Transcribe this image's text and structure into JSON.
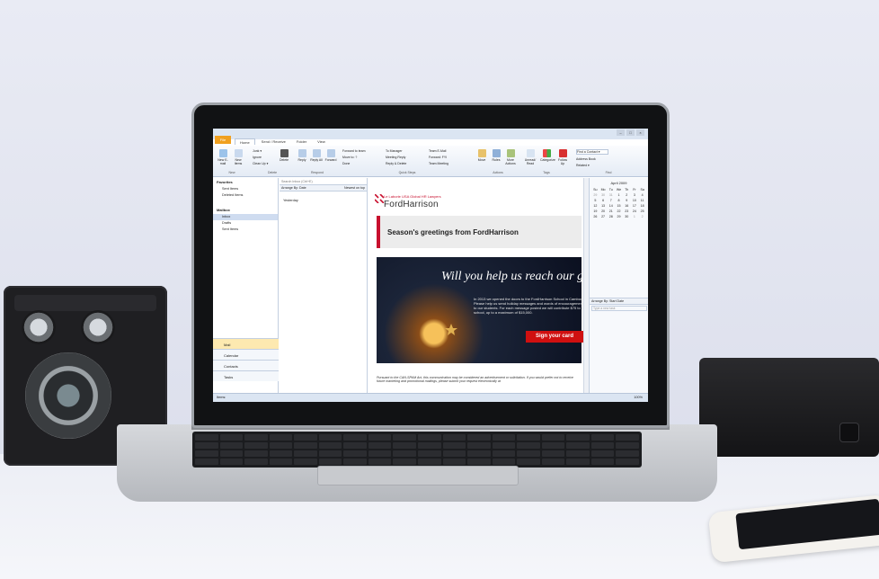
{
  "outlook": {
    "file_tab": "File",
    "tabs": [
      "Home",
      "Send / Receive",
      "Folder",
      "View"
    ],
    "window_controls": [
      "–",
      "□",
      "×"
    ],
    "ribbon": {
      "new_email": "New E-mail",
      "new_items": "New Items",
      "group_new": "New",
      "junk": "Junk ▾",
      "ignore": "Ignore",
      "clean_up": "Clean Up ▾",
      "delete": "Delete",
      "group_delete": "Delete",
      "reply": "Reply",
      "reply_all": "Reply All",
      "forward": "Forward",
      "group_respond": "Respond",
      "quick_steps": [
        "Forward to team",
        "Move to: ?",
        "Done",
        "To Manager",
        "Meeting Reply",
        "Reply & Delete",
        "Team E-Mail",
        "Forward: FYI",
        "Team Meeting"
      ],
      "group_quick_steps": "Quick Steps",
      "move": "Move",
      "rules": "Rules",
      "more_actions": "More Actions",
      "group_actions": "Actions",
      "unread_read": "Unread/ Read",
      "categorize": "Categorize",
      "follow_up": "Follow Up",
      "group_tags": "Tags",
      "find_contact": "Find a Contact ▾",
      "address_book": "Address Book",
      "related": "Related ▾",
      "group_find": "Find"
    },
    "nav": {
      "favorites": "Favorites",
      "favorites_items": [
        "Sent Items",
        "Deleted Items"
      ],
      "mailbox": "Mailbox",
      "mailbox_items": [
        "Inbox",
        "Drafts",
        "Sent Items"
      ],
      "sections": [
        "Mail",
        "Calendar",
        "Contacts",
        "Tasks"
      ]
    },
    "list": {
      "search_placeholder": "Search Inbox (Ctrl+E)",
      "arrange": "Arrange By: Date",
      "order": "Newest on top",
      "group": "Yesterday"
    },
    "message": {
      "tagline": "Le Laborie USA Global HR Lawyers",
      "brand": "FordHarrison",
      "greeting": "Season's greetings from FordHarrison",
      "hero_title": "Will you help us reach our goal?",
      "hero_body": "In 2013 we opened the doors to the FordHarrison School in Cambodia. Please help us send holiday messages and words of encouragement to our students. For each message posted we will contribute $75 to the school, up to a maximum of $15,000.",
      "cta": "Sign your card",
      "footer": "Pursuant to the CAN-SPAM Act, this communication may be considered an advertisement or solicitation. If you would prefer not to receive future marketing and promotional mailings, please submit your request electronically at"
    },
    "todo": {
      "month": "April 2009",
      "weekdays": [
        "Su",
        "Mo",
        "Tu",
        "We",
        "Th",
        "Fr",
        "Sa"
      ],
      "days": [
        "29",
        "30",
        "31",
        "1",
        "2",
        "3",
        "4",
        "5",
        "6",
        "7",
        "8",
        "9",
        "10",
        "11",
        "12",
        "13",
        "14",
        "15",
        "16",
        "17",
        "18",
        "19",
        "20",
        "21",
        "22",
        "23",
        "24",
        "25",
        "26",
        "27",
        "28",
        "29",
        "30",
        "1",
        "2"
      ],
      "arrange": "Arrange By: Start Date",
      "new_task_placeholder": "Type a new task"
    },
    "status": {
      "items": "Items: ",
      "zoom": "100%"
    }
  }
}
